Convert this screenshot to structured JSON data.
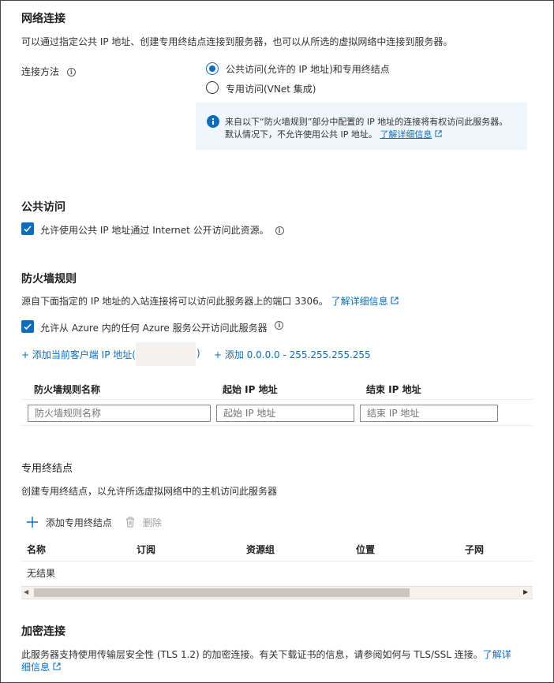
{
  "network": {
    "title": "网络连接",
    "description": "可以通过指定公共 IP 地址、创建专用终结点连接到服务器，也可以从所选的虚拟网络中连接到服务器。",
    "method_label": "连接方法",
    "options": [
      {
        "label": "公共访问(允许的 IP 地址)和专用终结点",
        "selected": true
      },
      {
        "label": "专用访问(VNet 集成)",
        "selected": false
      }
    ],
    "info_line1": "来自以下“防火墙规则”部分中配置的 IP 地址的连接将有权访问此服务器。",
    "info_line2": "默认情况下，不允许使用公共 IP 地址。",
    "info_link": "了解详细信息"
  },
  "public_access": {
    "title": "公共访问",
    "checkbox_label": "允许使用公共 IP 地址通过 Internet 公开访问此资源。",
    "checked": true
  },
  "firewall": {
    "title": "防火墙规则",
    "description": "源自下面指定的 IP 地址的入站连接将可以访问此服务器上的端口 3306。",
    "learn_more": "了解详细信息",
    "azure_checkbox_label": "允许从 Azure 内的任何 Azure 服务公开访问此服务器",
    "azure_checked": true,
    "add_client_ip": "+ 添加当前客户端 IP 地址(",
    "add_client_ip_close": ")",
    "add_all_range": "+ 添加 0.0.0.0 - 255.255.255.255",
    "columns": [
      "防火墙规则名称",
      "起始 IP 地址",
      "结束 IP 地址"
    ],
    "placeholders": {
      "name": "防火墙规则名称",
      "start": "起始 IP 地址",
      "end": "结束 IP 地址"
    }
  },
  "private_endpoint": {
    "title": "专用终结点",
    "description": "创建专用终结点，以允许所选虚拟网络中的主机访问此服务器",
    "add_label": "添加专用终结点",
    "delete_label": "删除",
    "columns": [
      "名称",
      "订阅",
      "资源组",
      "位置",
      "子网"
    ],
    "empty_text": "无结果"
  },
  "encrypted": {
    "title": "加密连接",
    "description_line1": "此服务器支持使用传输层安全性 (TLS 1.2) 的加密连接。有关下载证书的信息，请参阅如何与 TLS/SSL 连接。",
    "link_part1": "了解详",
    "link_part2": "细信息"
  },
  "colors": {
    "accent": "#0f6cbd",
    "info_bg": "#eff6fc"
  }
}
